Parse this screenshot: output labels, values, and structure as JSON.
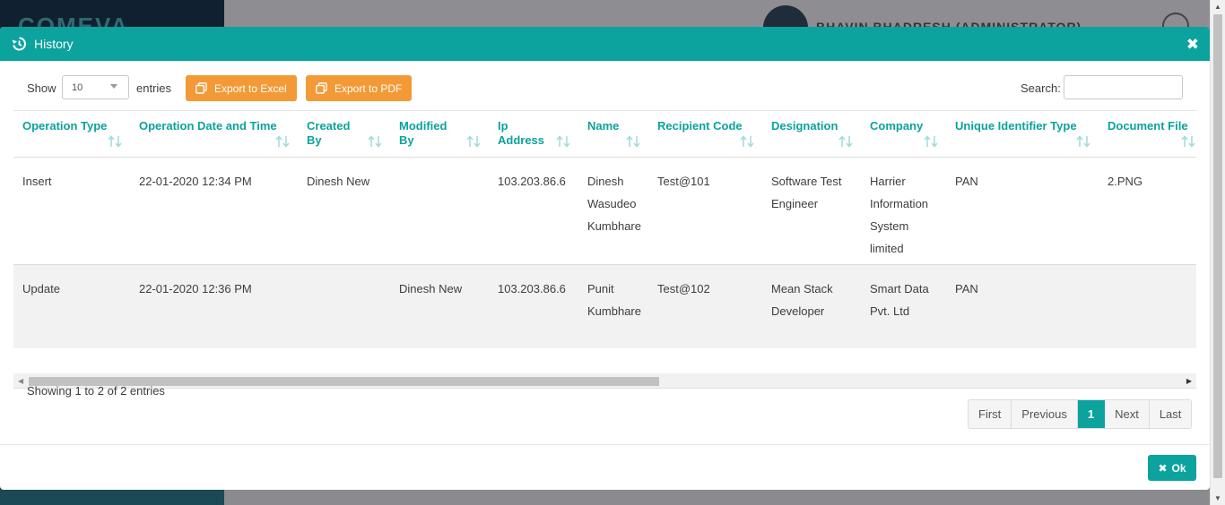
{
  "background": {
    "logo_text": "COMEVA",
    "user_name": "BHAVIN BHADRESH (ADMINISTRATOR)"
  },
  "modal": {
    "title": "History",
    "close_icon": "close-icon",
    "show_label": "Show",
    "entries_value": "10",
    "entries_label": "entries",
    "export_excel_label": "Export to Excel",
    "export_pdf_label": "Export to PDF",
    "search_label": "Search:",
    "search_value": "",
    "columns": [
      "Operation Type",
      "Operation Date and Time",
      "Created By",
      "Modified By",
      "Ip Address",
      "Name",
      "Recipient Code",
      "Designation",
      "Company",
      "Unique Identifier Type",
      "Document File"
    ],
    "rows": [
      {
        "operation_type": "Insert",
        "operation_date": "22-01-2020 12:34 PM",
        "created_by": "Dinesh New",
        "modified_by": "",
        "ip_address": "103.203.86.6",
        "name": "Dinesh Wasudeo Kumbhare",
        "recipient_code": "Test@101",
        "designation": "Software Test Engineer",
        "company": "Harrier Information System limited",
        "uid_type": "PAN",
        "document_file": "2.PNG"
      },
      {
        "operation_type": "Update",
        "operation_date": "22-01-2020 12:36 PM",
        "created_by": "",
        "modified_by": "Dinesh New",
        "ip_address": "103.203.86.6",
        "name": "Punit Kumbhare",
        "recipient_code": "Test@102",
        "designation": "Mean Stack Developer",
        "company": "Smart Data Pvt. Ltd",
        "uid_type": "PAN",
        "document_file": ""
      }
    ],
    "info_text": "Showing 1 to 2 of 2 entries",
    "pagination": {
      "first": "First",
      "previous": "Previous",
      "current": "1",
      "next": "Next",
      "last": "Last"
    },
    "ok_label": "Ok"
  },
  "colors": {
    "accent": "#0ca29d",
    "orange": "#f39a36"
  }
}
